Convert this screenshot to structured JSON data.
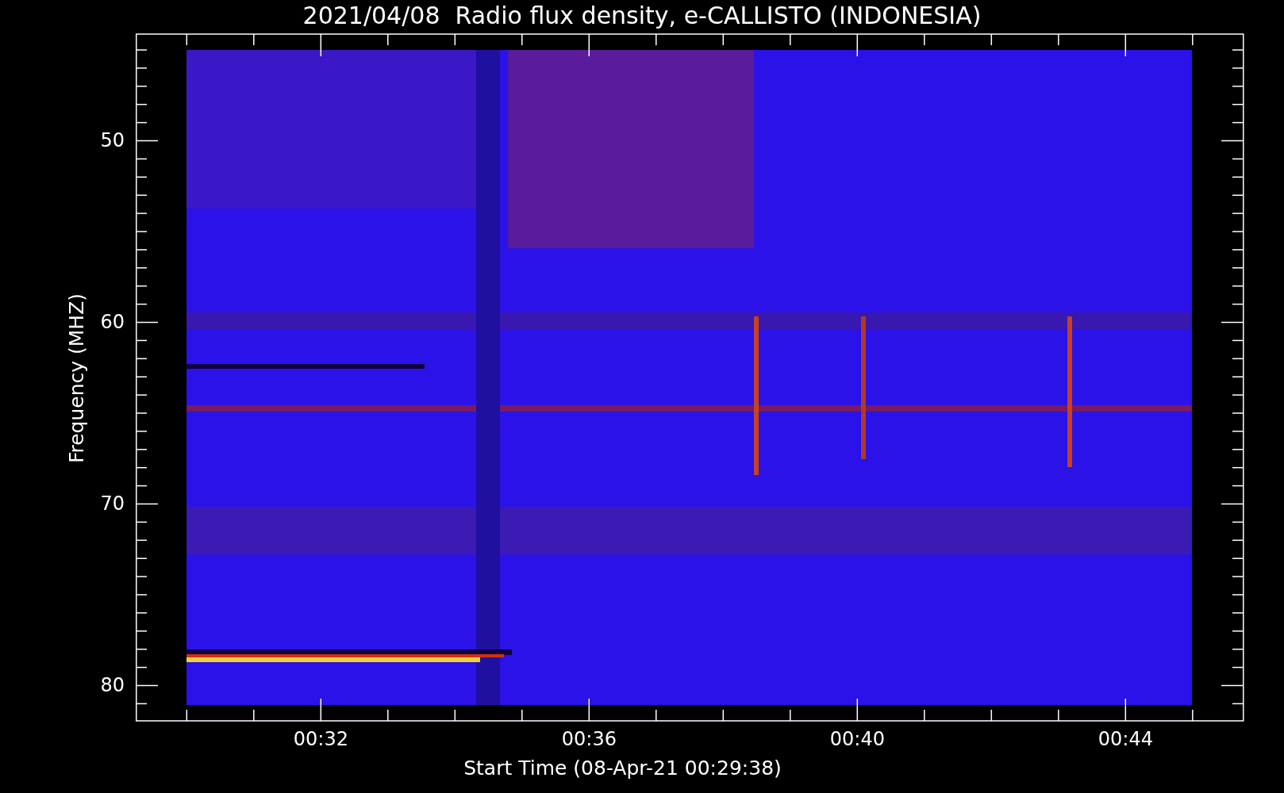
{
  "title": "2021/04/08  Radio flux density, e-CALLISTO (INDONESIA)",
  "y_axis": {
    "label": "Frequency (MHZ)",
    "ticks": [
      "50",
      "60",
      "70",
      "80"
    ]
  },
  "x_axis": {
    "label": "Start Time (08-Apr-21 00:29:38)",
    "ticks": [
      "00:32",
      "00:36",
      "00:40",
      "00:44"
    ]
  }
}
